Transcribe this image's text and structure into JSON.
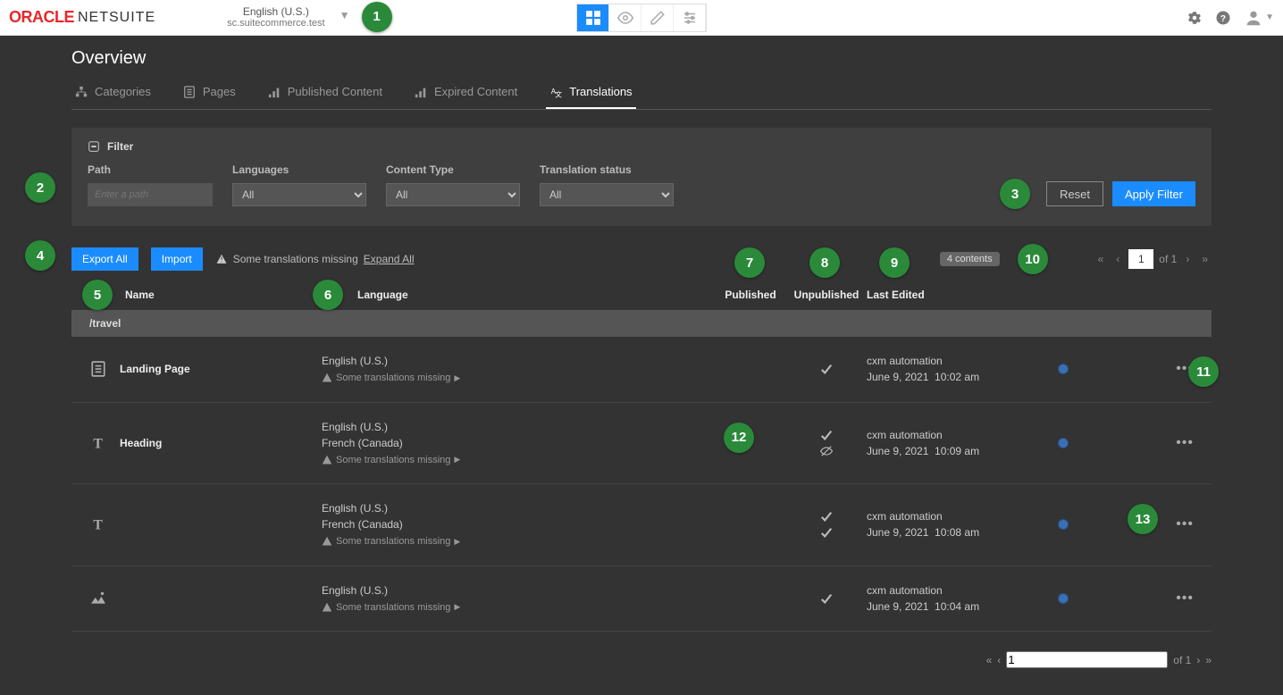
{
  "brand": {
    "oracle": "ORACLE",
    "netsuite": "NETSUITE"
  },
  "locale": {
    "language": "English (U.S.)",
    "domain": "sc.suitecommerce.test"
  },
  "page": {
    "title": "Overview"
  },
  "tabs": [
    {
      "label": "Categories"
    },
    {
      "label": "Pages"
    },
    {
      "label": "Published Content"
    },
    {
      "label": "Expired Content"
    },
    {
      "label": "Translations"
    }
  ],
  "filter": {
    "header": "Filter",
    "path_label": "Path",
    "path_placeholder": "Enter a path",
    "languages_label": "Languages",
    "languages_value": "All",
    "content_type_label": "Content Type",
    "content_type_value": "All",
    "status_label": "Translation status",
    "status_value": "All",
    "reset": "Reset",
    "apply": "Apply Filter"
  },
  "toolbar": {
    "export": "Export All",
    "import": "Import",
    "missing": "Some translations missing",
    "expand": "Expand All",
    "count_badge": "4 contents"
  },
  "columns": {
    "name": "Name",
    "language": "Language",
    "published": "Published",
    "unpublished": "Unpublished",
    "last_edited": "Last Edited"
  },
  "group": {
    "path": "/travel"
  },
  "rows": [
    {
      "icon": "page",
      "name": "Landing Page",
      "langs": [
        "English (U.S.)"
      ],
      "missing": "Some translations missing",
      "pub_icons": [
        "check"
      ],
      "user": "cxm automation",
      "date": "June 9, 2021",
      "time": "10:02 am"
    },
    {
      "icon": "text",
      "name": "Heading",
      "langs": [
        "English (U.S.)",
        "French (Canada)"
      ],
      "missing": "Some translations missing",
      "pub_icons": [
        "check",
        "hidden"
      ],
      "user": "cxm automation",
      "date": "June 9, 2021",
      "time": "10:09 am"
    },
    {
      "icon": "text",
      "name": "",
      "langs": [
        "English (U.S.)",
        "French (Canada)"
      ],
      "missing": "Some translations missing",
      "pub_icons": [
        "check",
        "check"
      ],
      "user": "cxm automation",
      "date": "June 9, 2021",
      "time": "10:08 am"
    },
    {
      "icon": "image",
      "name": "",
      "langs": [
        "English (U.S.)"
      ],
      "missing": "Some translations missing",
      "pub_icons": [
        "check"
      ],
      "user": "cxm automation",
      "date": "June 9, 2021",
      "time": "10:04 am"
    }
  ],
  "pager": {
    "page": "1",
    "of_label": "of 1"
  },
  "bubbles": {
    "1": "1",
    "2": "2",
    "3": "3",
    "4": "4",
    "5": "5",
    "6": "6",
    "7": "7",
    "8": "8",
    "9": "9",
    "10": "10",
    "11": "11",
    "12": "12",
    "13": "13"
  }
}
